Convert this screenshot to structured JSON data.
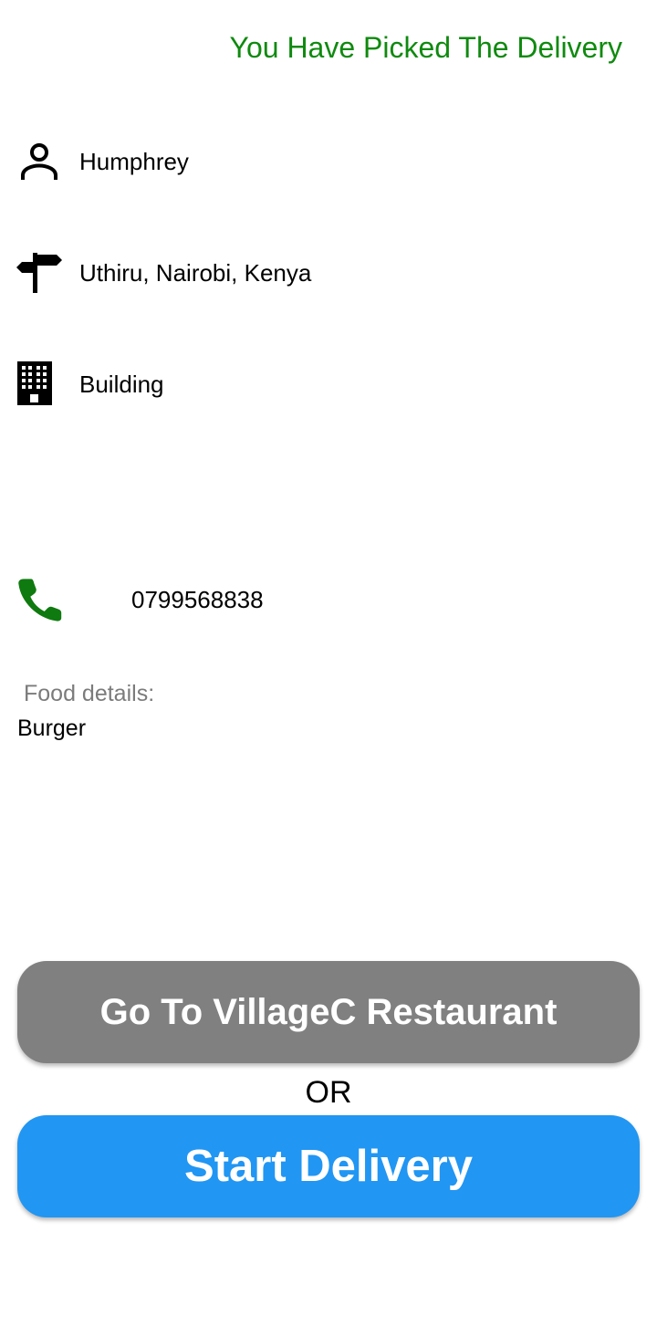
{
  "header": {
    "status_text": "You Have Picked The Delivery",
    "status_color": "#0f8a0f"
  },
  "details": {
    "customer_name": {
      "icon": "person-icon",
      "value": "Humphrey"
    },
    "address": {
      "icon": "signpost-icon",
      "value": "Uthiru, Nairobi, Kenya"
    },
    "building": {
      "icon": "building-icon",
      "value": "Building"
    },
    "phone": {
      "icon": "phone-icon",
      "value": "0799568838",
      "icon_color": "#0f7a0f"
    }
  },
  "food": {
    "label": "Food details:",
    "value": "Burger"
  },
  "actions": {
    "go_restaurant_label": "Go To VillageC Restaurant",
    "go_restaurant_color": "#808080",
    "or_label": "OR",
    "start_delivery_label": "Start Delivery",
    "start_delivery_color": "#2196f3"
  }
}
